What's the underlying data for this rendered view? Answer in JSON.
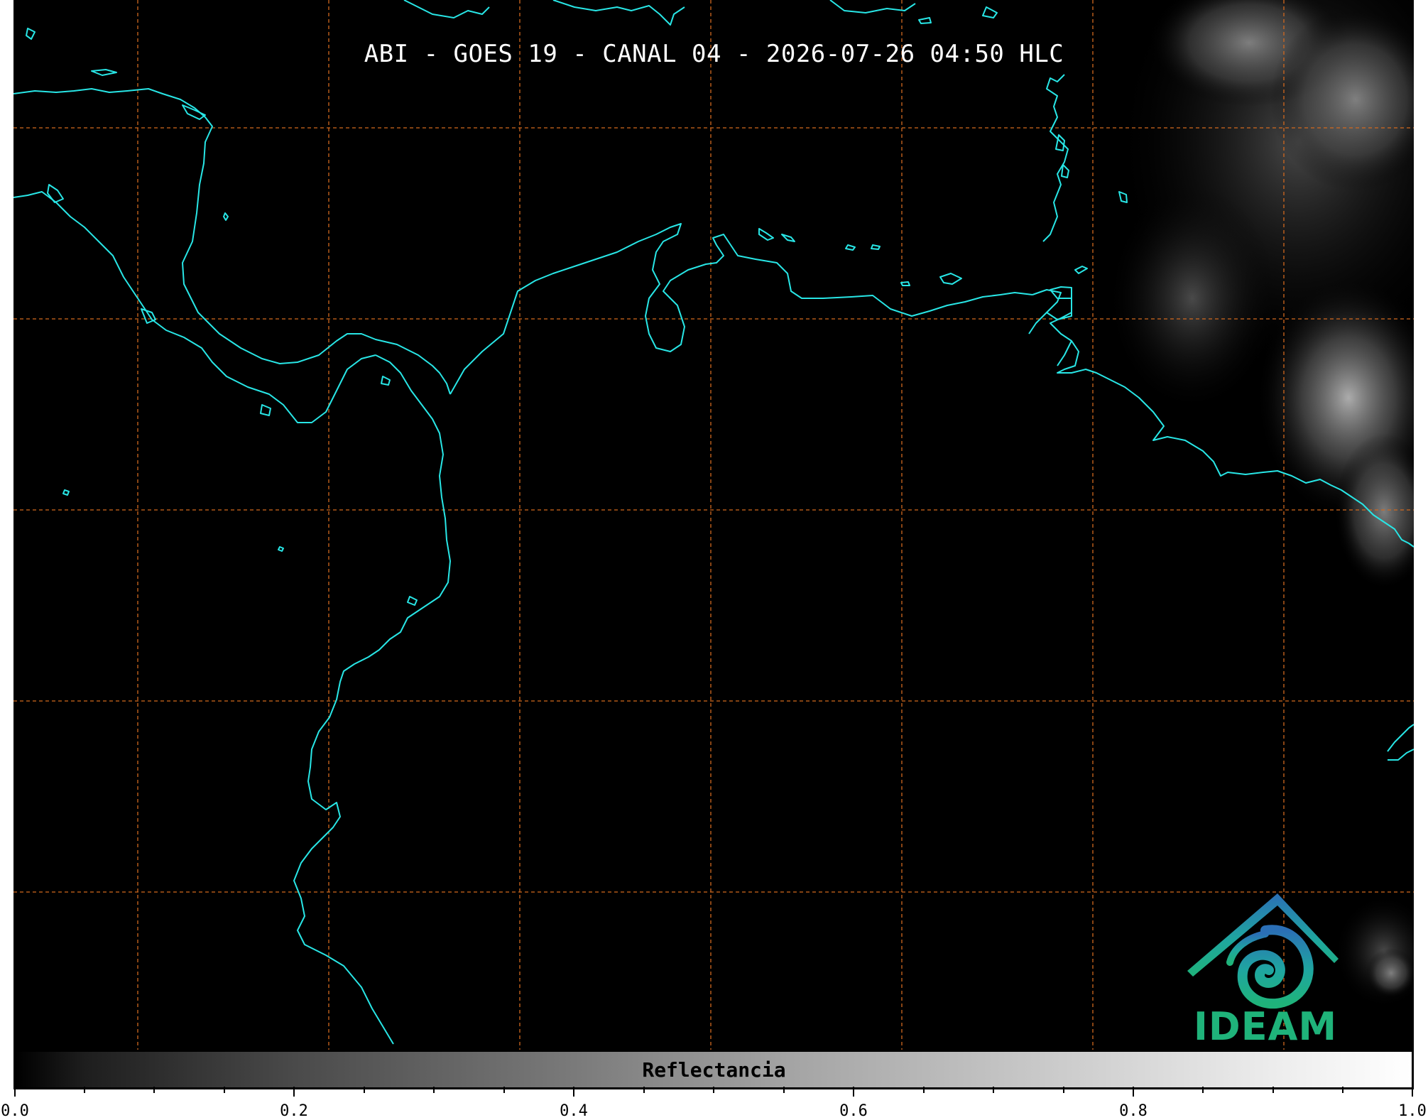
{
  "title": "ABI - GOES 19 - CANAL 04 - 2026-07-26 04:50 HLC",
  "colorbar": {
    "label": "Reflectancia",
    "min": 0.0,
    "max": 1.0,
    "tick_labels": [
      "0.0",
      "0.2",
      "0.4",
      "0.6",
      "0.8",
      "1.0"
    ],
    "colormap": "greys"
  },
  "logo": {
    "text": "IDEAM",
    "colors": [
      "#2b6fb6",
      "#1fa6a0",
      "#1fb37a"
    ]
  },
  "map": {
    "background_color": "#000000",
    "coastline_color": "#28e6e6",
    "gridline_color": "#d2691e",
    "gridline_style": "dashed"
  }
}
